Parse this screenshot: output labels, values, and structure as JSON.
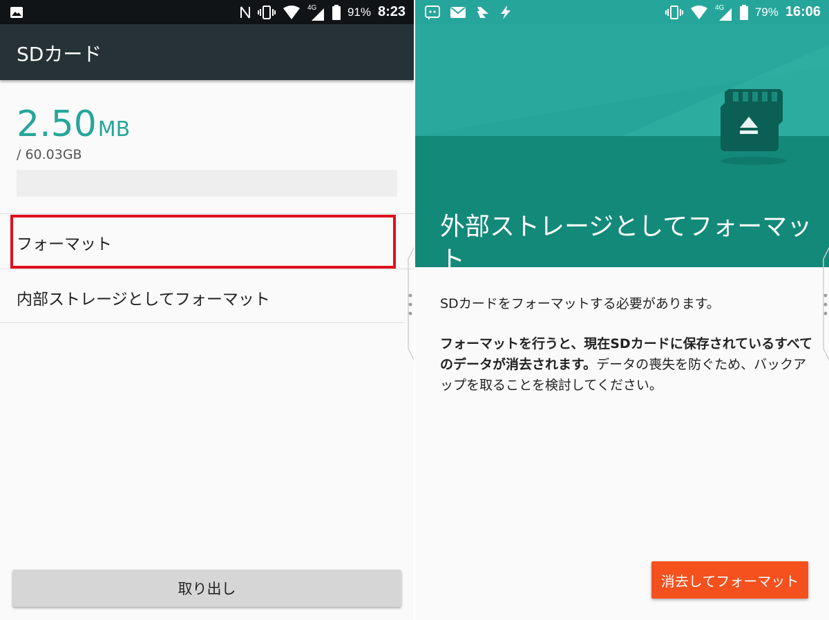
{
  "left": {
    "status": {
      "battery_pct": "91%",
      "time": "8:23",
      "network": "4G"
    },
    "title": "SDカード",
    "storage": {
      "used_value": "2.50",
      "used_unit": "MB",
      "total": "/ 60.03GB",
      "used_fraction": 4e-05
    },
    "menu": {
      "format": "フォーマット",
      "format_internal": "内部ストレージとしてフォーマット"
    },
    "eject_button": "取り出し"
  },
  "right": {
    "status": {
      "battery_pct": "79%",
      "time": "16:06",
      "network": "4G"
    },
    "hero_title": "外部ストレージとしてフォーマット",
    "desc1": "SDカードをフォーマットする必要があります。",
    "desc2_bold": "フォーマットを行うと、現在SDカードに保存されているすべてのデータが消去されます。",
    "desc2_rest": "データの喪失を防ぐため、バックアップを取ることを検討してください。",
    "erase_button": "消去してフォーマット"
  },
  "colors": {
    "accent": "#26a69a",
    "appbar": "#263238",
    "highlight": "#e0101c",
    "erase": "#f4511e"
  },
  "icons": {
    "left_status": [
      "image-notification-icon",
      "nfc-icon",
      "vibrate-icon",
      "wifi-icon",
      "signal-icon",
      "battery-icon"
    ],
    "right_status": [
      "messenger-icon",
      "mail-icon",
      "feedly-icon",
      "flash-icon",
      "vibrate-icon",
      "wifi-icon",
      "signal-icon",
      "battery-icon"
    ]
  }
}
